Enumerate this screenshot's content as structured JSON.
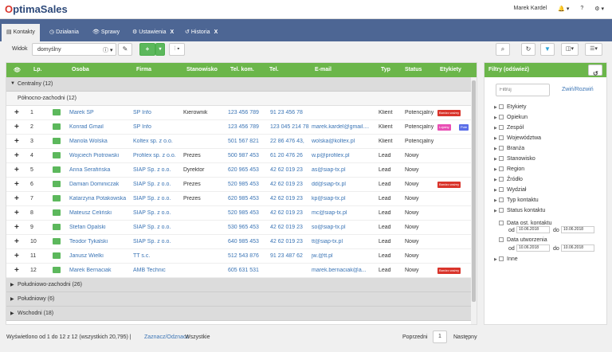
{
  "app": {
    "logo_first": "O",
    "logo_rest": "ptimaSales",
    "user": "Marek Kardel"
  },
  "topbar": {
    "bell": "🔔 ▾",
    "help": "?",
    "gear": "⚙ ▾"
  },
  "tabs": [
    {
      "label": "Kontakty",
      "icon": "▤"
    },
    {
      "label": "Działania",
      "icon": "◷"
    },
    {
      "label": "Sprawy",
      "icon": "👁"
    },
    {
      "label": "Ustawienia",
      "icon": "⚙",
      "close": "X"
    },
    {
      "label": "Historia",
      "icon": "↺",
      "close": "X"
    }
  ],
  "toolbar": {
    "view_label": "Widok",
    "view_value": "domyślny",
    "add": "+",
    "add_caret": "▾",
    "cols": "⫶ ▾"
  },
  "grid": {
    "columns": [
      "Lp.",
      "Osoba",
      "Firma",
      "Stanowisko",
      "Tel. kom.",
      "Tel.",
      "E-mail",
      "Typ",
      "Status",
      "Etykiety"
    ],
    "groups": [
      {
        "label": "Centralny (12)"
      },
      {
        "label": "Północno-zachodni (12)"
      },
      {
        "label": "Południowo-zachodni (26)"
      },
      {
        "label": "Południowy (6)"
      },
      {
        "label": "Wschodni (18)"
      }
    ],
    "rows": [
      {
        "lp": "1",
        "osoba": "Marek SP",
        "firma": "SP Info",
        "stanowisko": "Kierownik",
        "telkom": "123 456 789",
        "tel": "91 23 456 78",
        "email": "",
        "typ": "Klient",
        "status": "Potencjalny",
        "badges": [
          {
            "t": "Bardzo ważny",
            "c": "#d9342b"
          }
        ]
      },
      {
        "lp": "2",
        "osoba": "Konrad Gmail",
        "firma": "SP Info",
        "stanowisko": "",
        "telkom": "123 456 789",
        "tel": "123 045 214 78",
        "email": "marek.kardel@gmail....",
        "typ": "Klient",
        "status": "Potencjalny",
        "badges": [
          {
            "t": "Lojalny",
            "c": "#e94fb5"
          },
          {
            "t": "Pote",
            "c": "#5b6ee8"
          }
        ]
      },
      {
        "lp": "3",
        "osoba": "Mariola Wolska",
        "firma": "Koltex sp. z o.o.",
        "stanowisko": "",
        "telkom": "501 567 821",
        "tel": "22 86 476 43,",
        "email": "wolska@koltex.pl",
        "typ": "Klient",
        "status": "Potencjalny",
        "badges": []
      },
      {
        "lp": "4",
        "osoba": "Wojciech Piotrowski",
        "firma": "Profilex sp. z o.o.",
        "stanowisko": "Prezes",
        "telkom": "500 987 453",
        "tel": "61 20 476 26",
        "email": "w.p@profilex.pl",
        "typ": "Lead",
        "status": "Nowy",
        "badges": []
      },
      {
        "lp": "5",
        "osoba": "Anna Serafińska",
        "firma": "SIAP Sp. z o.o.",
        "stanowisko": "Dyrektor",
        "telkom": "620 965 453",
        "tel": "42 62 019 23",
        "email": "as@siap-tx.pl",
        "typ": "Lead",
        "status": "Nowy",
        "badges": []
      },
      {
        "lp": "6",
        "osoba": "Damian Dominiczak",
        "firma": "SIAP Sp. z o.o.",
        "stanowisko": "Prezes",
        "telkom": "520 985 453",
        "tel": "42 62 019 23",
        "email": "dd@siap-tx.pl",
        "typ": "Lead",
        "status": "Nowy",
        "badges": [
          {
            "t": "Bardzo ważny",
            "c": "#d9342b"
          }
        ]
      },
      {
        "lp": "7",
        "osoba": "Katarzyna Potakowska",
        "firma": "SIAP Sp. z o.o.",
        "stanowisko": "Prezes",
        "telkom": "620 985 453",
        "tel": "42 62 019 23",
        "email": "kp@siap-tx.pl",
        "typ": "Lead",
        "status": "Nowy",
        "badges": []
      },
      {
        "lp": "8",
        "osoba": "Mateusz Celiński",
        "firma": "SIAP Sp. z o.o.",
        "stanowisko": "",
        "telkom": "520 985 453",
        "tel": "42 62 019 23",
        "email": "mc@siap-tx.pl",
        "typ": "Lead",
        "status": "Nowy",
        "badges": []
      },
      {
        "lp": "9",
        "osoba": "Stefan Opalski",
        "firma": "SIAP Sp. z o.o.",
        "stanowisko": "",
        "telkom": "530 965 453",
        "tel": "42 62 019 23",
        "email": "so@siap-tx.pl",
        "typ": "Lead",
        "status": "Nowy",
        "badges": []
      },
      {
        "lp": "10",
        "osoba": "Teodor Tykalski",
        "firma": "SIAP Sp. z o.o.",
        "stanowisko": "",
        "telkom": "640 985 453",
        "tel": "42 62 019 23",
        "email": "tt@siap-tx.pl",
        "typ": "Lead",
        "status": "Nowy",
        "badges": []
      },
      {
        "lp": "11",
        "osoba": "Janusz Wielki",
        "firma": "TT s.c.",
        "stanowisko": "",
        "telkom": "512 543 876",
        "tel": "91 23 487 62",
        "email": "jw.@tt.pl",
        "typ": "Lead",
        "status": "Nowy",
        "badges": []
      },
      {
        "lp": "12",
        "osoba": "Marek Bernaciak",
        "firma": "AMB Technic",
        "stanowisko": "",
        "telkom": "605 631 531",
        "tel": "",
        "email": "marek.bernaciak@a...",
        "typ": "Lead",
        "status": "Nowy",
        "badges": [
          {
            "t": "Bardzo ważny",
            "c": "#d9342b"
          }
        ]
      }
    ]
  },
  "filters": {
    "title": "Filtry (odśwież)",
    "search_placeholder": "Filtruj",
    "toggle": "Zwiń/Rozwiń",
    "items": [
      "Etykiety",
      "Opiekun",
      "Zespół",
      "Województwa",
      "Branża",
      "Stanowisko",
      "Region",
      "Źródło",
      "Wydział",
      "Typ kontaktu",
      "Status kontaktu"
    ],
    "date1_label": "Data ost. kontaktu",
    "date2_label": "Data utworzenia",
    "from": "od",
    "to": "do",
    "date_from": "10.06.2018",
    "date_to": "10.06.2018",
    "last": "Inne"
  },
  "footer": {
    "summary": "Wyświetlono od 1 do 12 z 12 (wszystkich 20,795) |",
    "select_all": "Zaznacz/Odznacz",
    "select_all_suffix": "Wszystkie",
    "prev": "Poprzedni",
    "page": "1",
    "next": "Następny"
  }
}
